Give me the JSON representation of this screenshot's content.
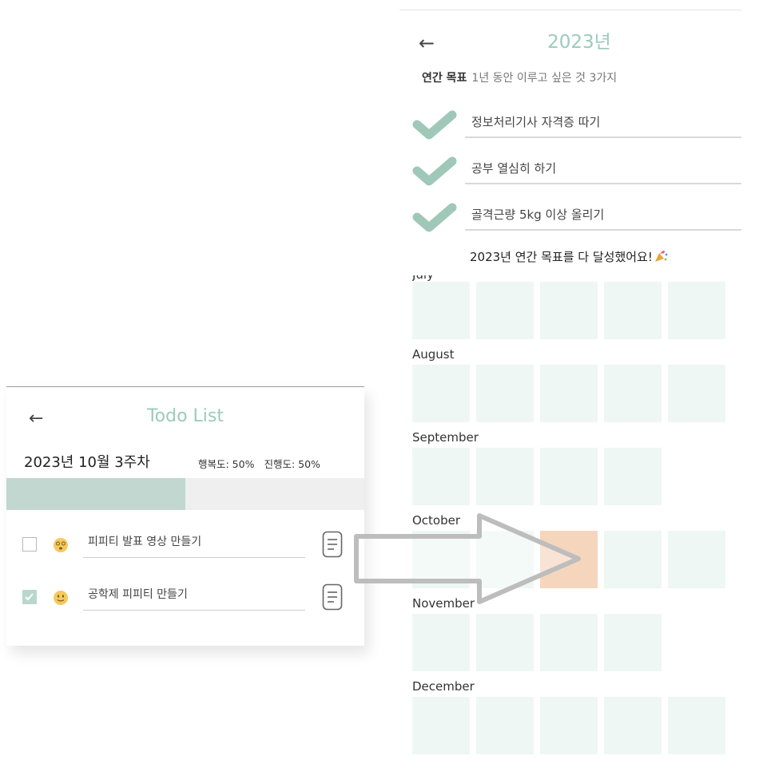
{
  "year_screen": {
    "back_icon": "arrow-left-icon",
    "title": "2023년",
    "goal_header": {
      "label": "연간 목표",
      "subtitle": "1년 동안 이루고 싶은 것 3가지"
    },
    "goals": [
      {
        "text": "정보처리기사 자격증 따기",
        "done": true
      },
      {
        "text": "공부 열심히 하기",
        "done": true
      },
      {
        "text": "골격근량 5kg 이상 올리기",
        "done": true
      }
    ],
    "completion_message": "2023년 연간 목표를 다 달성했어요!",
    "completion_icon": "party-popper-icon",
    "months": [
      {
        "label": "July",
        "weeks": 5,
        "highlight": null
      },
      {
        "label": "August",
        "weeks": 5,
        "highlight": null
      },
      {
        "label": "September",
        "weeks": 4,
        "highlight": null
      },
      {
        "label": "October",
        "weeks": 5,
        "highlight": 2
      },
      {
        "label": "November",
        "weeks": 4,
        "highlight": null
      },
      {
        "label": "December",
        "weeks": 5,
        "highlight": null
      }
    ],
    "colors": {
      "accent": "#9ccbbb",
      "cell": "#eef7f3",
      "highlight": "#f6d5bd",
      "check": "#9fc8b8"
    }
  },
  "todo_screen": {
    "back_icon": "arrow-left-icon",
    "title": "Todo List",
    "week_label": "2023년 10월 3주차",
    "happiness_label": "행복도: 50%",
    "progress_label": "진행도: 50%",
    "progress_fraction": 0.5,
    "items": [
      {
        "text": "피피티 발표 영상 만들기",
        "checked": false,
        "emoji_icon": "dizzy-face-icon",
        "memo_icon": "memo-icon"
      },
      {
        "text": "공학제 피피티 만들기",
        "checked": true,
        "emoji_icon": "smiling-face-icon",
        "memo_icon": "memo-icon"
      }
    ],
    "colors": {
      "accent": "#9ccbbb",
      "progress": "#c1d7cf",
      "track": "#efefef"
    }
  }
}
